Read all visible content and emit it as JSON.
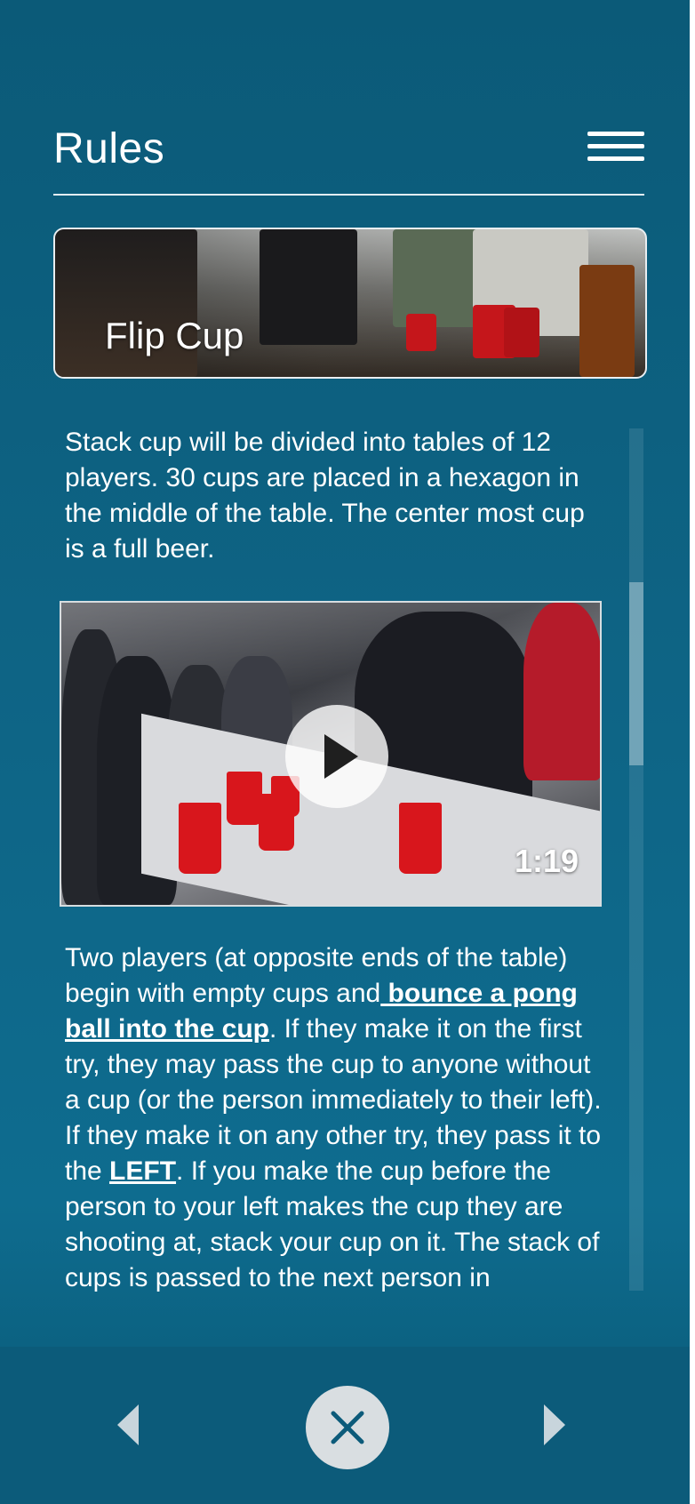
{
  "header": {
    "title": "Rules",
    "menu_icon": "hamburger-menu-icon"
  },
  "banner": {
    "title": "Flip Cup"
  },
  "content": {
    "paragraph1": "Stack cup will be divided into tables of 12 players.  30 cups are placed in a hexagon in the middle of the table. The center most cup is a full beer.",
    "video": {
      "duration": "1:19",
      "play_icon": "play-icon"
    },
    "paragraph2": {
      "part1": "Two players (at opposite ends of the table) begin with empty cups and",
      "link1": " bounce a pong ball into the cup",
      "part2": ". If they make it on the first try, they may pass the cup to anyone without a cup (or the person immediately to their left). If they make it on any other try, they pass it to the ",
      "emphasis": "LEFT",
      "part3": ". If you make the cup before the person to your left makes the cup they are shooting at, stack your cup on it. The stack of cups is passed to the next person in"
    }
  },
  "bottom_nav": {
    "prev_icon": "chevron-left-icon",
    "close_icon": "close-icon",
    "next_icon": "chevron-right-icon"
  },
  "colors": {
    "background": "#0e6485",
    "text": "#ffffff",
    "accent": "#0c5b7a"
  }
}
